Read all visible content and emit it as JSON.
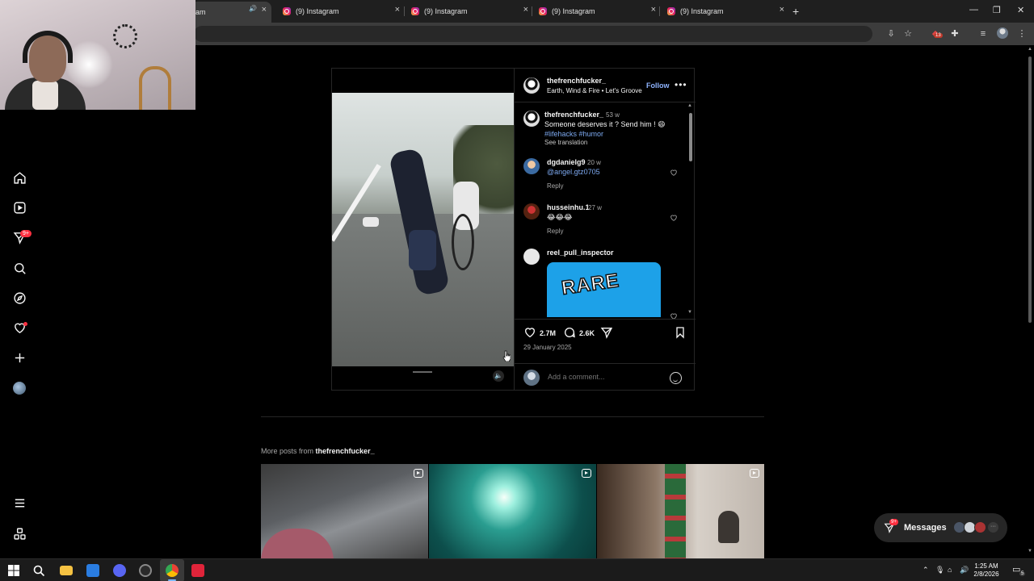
{
  "browser": {
    "tabs": [
      {
        "label": "am",
        "active": true
      },
      {
        "label": "(9) Instagram"
      },
      {
        "label": "(9) Instagram"
      },
      {
        "label": "(9) Instagram"
      },
      {
        "label": "(9) Instagram"
      }
    ],
    "extension_badge": "13"
  },
  "nav": {
    "items": [
      "home-icon",
      "reels-icon",
      "messenger-icon",
      "search-icon",
      "explore-icon",
      "notifications-icon",
      "create-icon",
      "profile-avatar"
    ],
    "messages_badge": "9+",
    "bottom": [
      "menu-icon",
      "threads-icon"
    ]
  },
  "post": {
    "username": "thefrenchfucker_",
    "audio": "Earth, Wind & Fire • Let's Groove",
    "follow_label": "Follow",
    "more_label": "•••",
    "caption": {
      "username": "thefrenchfucker_",
      "age": "53 w",
      "text": "Someone deserves it ? Send him ! 😄",
      "hashtags": "#lifehacks #humor",
      "see_translation": "See translation"
    },
    "comments": [
      {
        "username": "dgdanielg9",
        "age": "20 w",
        "text": "@angel.gtz0705",
        "reply": "Reply"
      },
      {
        "username": "husseinhu.1",
        "age": "27 w",
        "text": "😂😂😂",
        "reply": "Reply"
      },
      {
        "username": "reel_pull_inspector",
        "age": "",
        "sticker": "RARE"
      }
    ],
    "likes": "2.7M",
    "comments_count": "2.6K",
    "date": "29 January 2025",
    "add_comment_placeholder": "Add a comment..."
  },
  "more_posts": {
    "prefix": "More posts from",
    "username": "thefrenchfucker_",
    "thumbnails": 3
  },
  "messages_bar": {
    "label": "Messages",
    "badge": "9+"
  },
  "taskbar": {
    "time": "1:25 AM",
    "date": "2/8/2026",
    "notification_count": "5"
  },
  "colors": {
    "background": "#000000",
    "link_blue": "#7da9f0",
    "follow_blue": "#8fb4ff",
    "badge_red": "#ff3040"
  }
}
